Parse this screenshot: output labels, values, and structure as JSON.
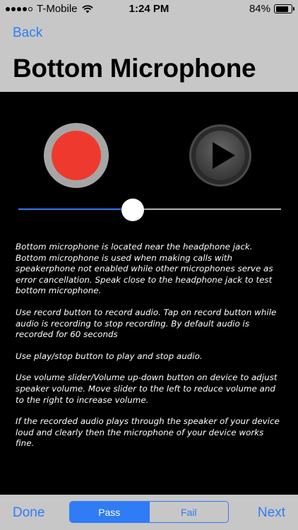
{
  "status_bar": {
    "carrier": "T-Mobile",
    "time": "1:24 PM",
    "battery": "84%",
    "battery_level": 0.84,
    "signal_bars": 4
  },
  "nav": {
    "back_label": "Back",
    "title": "Bottom Microphone"
  },
  "controls": {
    "record_icon": "record-circle-icon",
    "play_icon": "play-triangle-icon",
    "volume_level": 0.43
  },
  "description": {
    "paragraphs": [
      "Bottom microphone is located near the headphone jack. Bottom microphone is used when making calls with speakerphone not enabled while other microphones serve as error cancellation. Speak close to the headphone jack to test bottom microphone.",
      "Use record button to record audio. Tap on record button while audio is recording to stop recording. By default audio is recorded for 60 seconds",
      "Use play/stop button to play and stop audio.",
      "Use volume slider/Volume up-down button on device to adjust speaker volume. Move slider to the left to reduce volume and to the right to increase volume.",
      "If the recorded audio plays through the speaker of your device loud and clearly then the microphone of your device works fine."
    ]
  },
  "toolbar": {
    "done_label": "Done",
    "pass_label": "Pass",
    "fail_label": "Fail",
    "next_label": "Next",
    "selected": "Pass"
  },
  "colors": {
    "accent": "#2f7cf6",
    "record": "#ee3a2e",
    "bar_background": "#c7c7c7",
    "content_background": "#000000"
  }
}
